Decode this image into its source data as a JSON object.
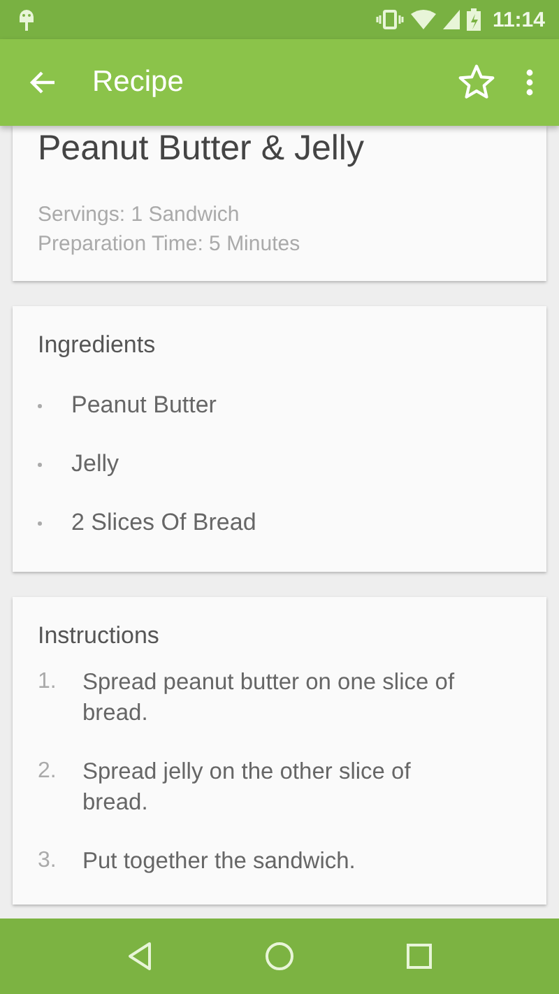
{
  "status_bar": {
    "time": "11:14"
  },
  "app_bar": {
    "title": "Recipe",
    "favorite": false
  },
  "recipe": {
    "title": "Peanut Butter & Jelly",
    "details": [
      "Servings: 1 Sandwich",
      "Preparation Time: 5 Minutes"
    ]
  },
  "ingredients": {
    "heading": "Ingredients",
    "items": [
      "Peanut Butter",
      "Jelly",
      "2 Slices Of Bread"
    ]
  },
  "instructions": {
    "heading": "Instructions",
    "steps": [
      {
        "number": "1.",
        "text": "Spread peanut butter on one slice of bread."
      },
      {
        "number": "2.",
        "text": "Spread jelly on the other slice of bread."
      },
      {
        "number": "3.",
        "text": "Put together the sandwich."
      }
    ]
  }
}
